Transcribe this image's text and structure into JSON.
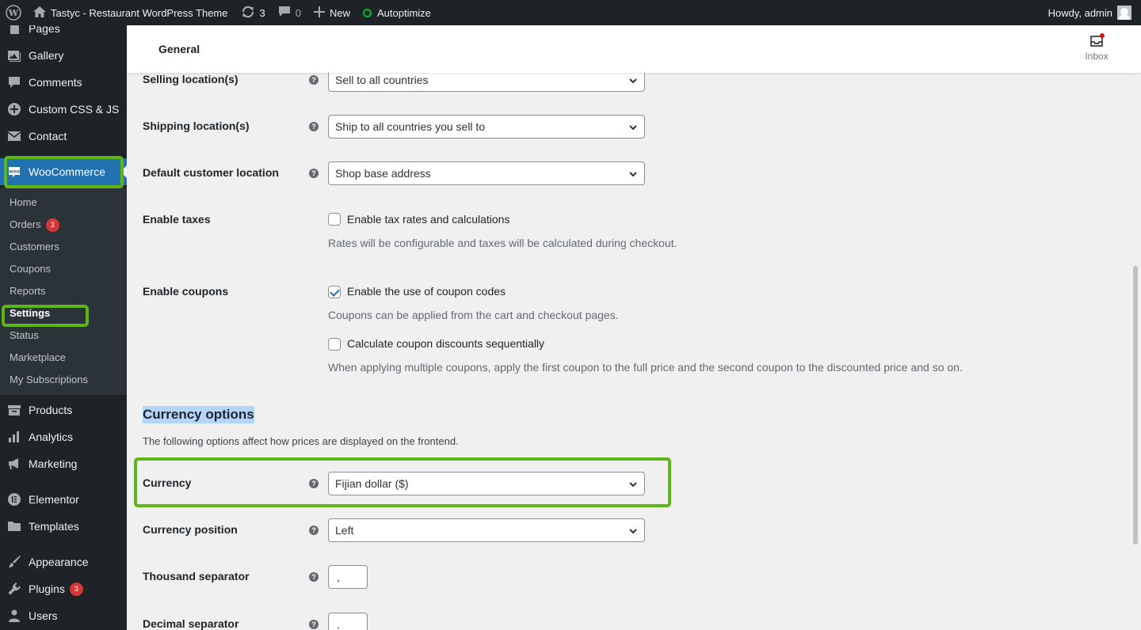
{
  "adminbar": {
    "site_name": "Tastyc - Restaurant WordPress Theme",
    "updates_count": "3",
    "comments_count": "0",
    "new_label": "New",
    "autoptimize_label": "Autoptimize",
    "howdy": "Howdy, admin"
  },
  "sidebar": {
    "menu": [
      {
        "label": "Pages",
        "icon": "pages-icon"
      },
      {
        "label": "Gallery",
        "icon": "gallery-icon"
      },
      {
        "label": "Comments",
        "icon": "comments-icon"
      },
      {
        "label": "Custom CSS & JS",
        "icon": "plus-circle-icon"
      },
      {
        "label": "Contact",
        "icon": "mail-icon"
      },
      {
        "label": "WooCommerce",
        "icon": "woocommerce-icon"
      }
    ],
    "submenu": [
      {
        "label": "Home"
      },
      {
        "label": "Orders",
        "badge": "3"
      },
      {
        "label": "Customers"
      },
      {
        "label": "Coupons"
      },
      {
        "label": "Reports"
      },
      {
        "label": "Settings"
      },
      {
        "label": "Status"
      },
      {
        "label": "Marketplace"
      },
      {
        "label": "My Subscriptions"
      }
    ],
    "menu_lower": [
      {
        "label": "Products",
        "icon": "archive-icon"
      },
      {
        "label": "Analytics",
        "icon": "chart-icon"
      },
      {
        "label": "Marketing",
        "icon": "megaphone-icon"
      },
      {
        "label": "Elementor",
        "icon": "elementor-icon"
      },
      {
        "label": "Templates",
        "icon": "folder-icon"
      },
      {
        "label": "Appearance",
        "icon": "brush-icon"
      },
      {
        "label": "Plugins",
        "icon": "plugin-icon",
        "badge": "3"
      },
      {
        "label": "Users",
        "icon": "users-icon"
      }
    ]
  },
  "header": {
    "title": "General",
    "inbox_label": "Inbox"
  },
  "settings": {
    "selling_locations": {
      "label": "Selling location(s)",
      "value": "Sell to all countries"
    },
    "shipping_locations": {
      "label": "Shipping location(s)",
      "value": "Ship to all countries you sell to"
    },
    "default_customer_location": {
      "label": "Default customer location",
      "value": "Shop base address"
    },
    "enable_taxes": {
      "label": "Enable taxes",
      "checkbox_label": "Enable tax rates and calculations",
      "checked": false,
      "desc": "Rates will be configurable and taxes will be calculated during checkout."
    },
    "enable_coupons": {
      "label": "Enable coupons",
      "checkbox1_label": "Enable the use of coupon codes",
      "checkbox1_checked": true,
      "desc1": "Coupons can be applied from the cart and checkout pages.",
      "checkbox2_label": "Calculate coupon discounts sequentially",
      "checkbox2_checked": false,
      "desc2": "When applying multiple coupons, apply the first coupon to the full price and the second coupon to the discounted price and so on."
    },
    "currency_section": {
      "title": "Currency options",
      "desc": "The following options affect how prices are displayed on the frontend."
    },
    "currency": {
      "label": "Currency",
      "value": "Fijian dollar ($)"
    },
    "currency_position": {
      "label": "Currency position",
      "value": "Left"
    },
    "thousand_separator": {
      "label": "Thousand separator",
      "value": ","
    },
    "decimal_separator": {
      "label": "Decimal separator",
      "value": "."
    }
  },
  "colors": {
    "admin_dark": "#1d2327",
    "wp_blue": "#2271b1",
    "highlight_green": "#5cb615",
    "badge_red": "#d63638"
  }
}
